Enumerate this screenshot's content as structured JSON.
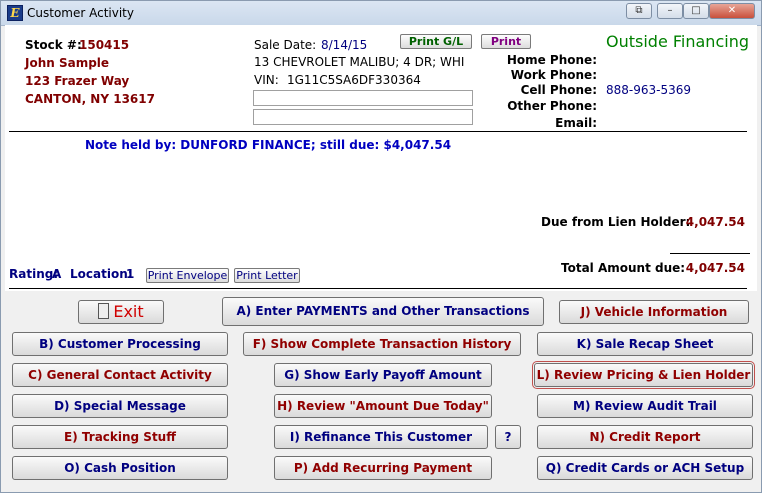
{
  "window": {
    "title": "Customer Activity",
    "icon_letter": "E",
    "controls": {
      "extra": "⧉",
      "minimize": "–",
      "maximize": "□",
      "close": "✕"
    }
  },
  "customer": {
    "stock_label": "Stock #:",
    "stock_number": "150415",
    "name": "John Sample",
    "address1": "123 Frazer Way",
    "city_state_zip": "CANTON, NY 13617"
  },
  "sale": {
    "date_label": "Sale Date:",
    "date": "8/14/15",
    "vehicle": "13 CHEVROLET MALIBU; 4 DR; WHI",
    "vin_label": "VIN:",
    "vin": "1G11C5SA6DF330364",
    "field1": "",
    "field2": ""
  },
  "print_gl_label": "Print G/L",
  "print_label": "Print",
  "financing_type": "Outside Financing",
  "phones": {
    "home_label": "Home Phone:",
    "home": "",
    "work_label": "Work Phone:",
    "work": "",
    "cell_label": "Cell Phone:",
    "cell": "888-963-5369",
    "other_label": "Other Phone:",
    "other": "",
    "email_label": "Email:",
    "email": ""
  },
  "note": "Note held by: DUNFORD FINANCE; still due: $4,047.54",
  "due": {
    "lien_label": "Due from Lien Holder:",
    "lien_amount": "4,047.54",
    "total_label": "Total Amount due:",
    "total_amount": "4,047.54"
  },
  "rating": {
    "label": "Rating:",
    "value": "A"
  },
  "location": {
    "label": "Location:",
    "value": "1"
  },
  "print_envelope_label": "Print Envelope",
  "print_letter_label": "Print Letter",
  "actions": {
    "exit": "Exit",
    "a": "A) Enter PAYMENTS and Other Transactions",
    "j": "J) Vehicle Information",
    "b": "B) Customer Processing",
    "f": "F) Show Complete Transaction History",
    "k": "K) Sale Recap Sheet",
    "c": "C) General Contact Activity",
    "g": "G) Show Early Payoff Amount",
    "l": "L) Review Pricing & Lien Holder",
    "d": "D) Special Message",
    "h": "H) Review \"Amount Due Today\"",
    "m": "M) Review Audit Trail",
    "e": "E) Tracking Stuff",
    "i": "I) Refinance This Customer",
    "help": "?",
    "n": "N) Credit Report",
    "o": "O) Cash Position",
    "p": "P) Add Recurring Payment",
    "q": "Q) Credit Cards or ACH Setup"
  }
}
